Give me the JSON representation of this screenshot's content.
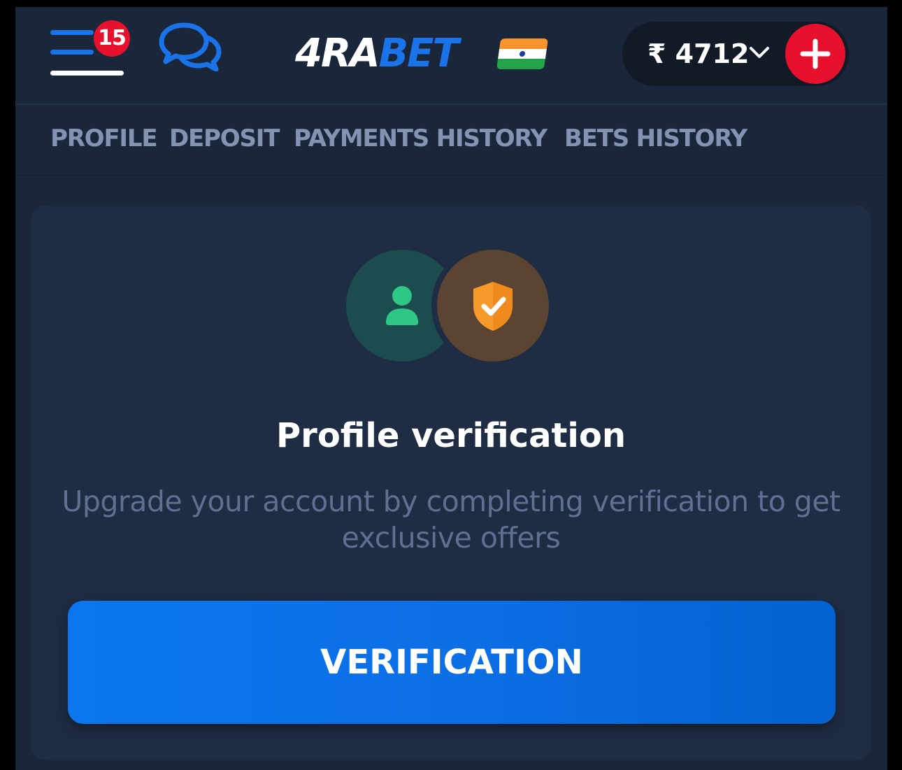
{
  "header": {
    "notification_count": "15",
    "logo": {
      "part1": "4RA",
      "part2": "BET"
    },
    "balance": {
      "currency_symbol": "₹",
      "amount": "4712",
      "display": "₹ 4712"
    },
    "icons": {
      "menu": "hamburger-menu-icon",
      "chat": "chat-bubbles-icon",
      "flag": "india-flag-icon",
      "chevron": "chevron-down-icon",
      "add": "plus-icon"
    }
  },
  "tabs": [
    {
      "label": "PROFILE"
    },
    {
      "label": "DEPOSIT"
    },
    {
      "label": "PAYMENTS HISTORY"
    },
    {
      "label": "BETS HISTORY"
    }
  ],
  "card": {
    "title": "Profile verification",
    "subtitle": "Upgrade your account by completing verification to get exclusive offers",
    "button_label": "VERIFICATION",
    "icons": {
      "user": "user-icon",
      "shield": "shield-check-icon"
    }
  },
  "colors": {
    "background": "#1a263a",
    "card": "#1e2c44",
    "accent_blue": "#1a73e8",
    "accent_red": "#e8112d",
    "tab_text": "#8394b2",
    "user_green": "#2ec786",
    "shield_orange": "#f79a2c"
  }
}
